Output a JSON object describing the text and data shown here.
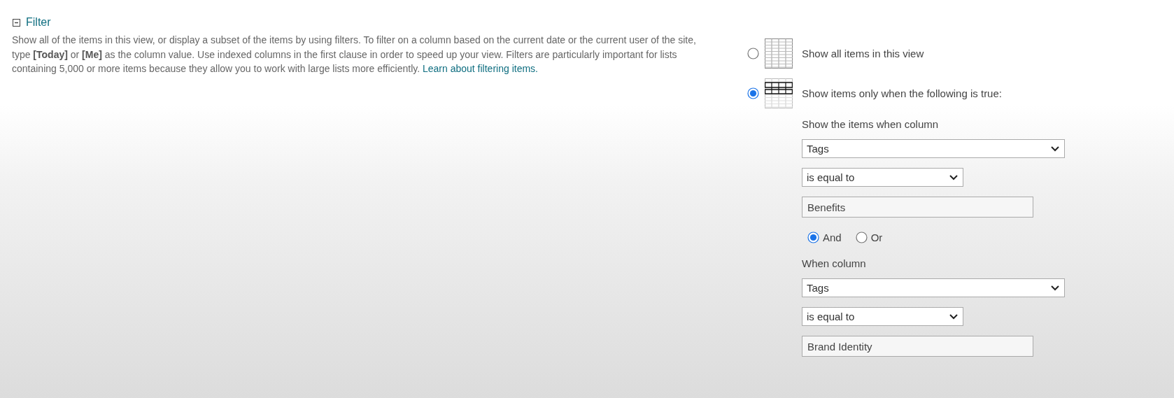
{
  "section": {
    "title": "Filter",
    "expanded": true,
    "description": "Show all of the items in this view, or display a subset of the items by using filters. To filter on a column based on the current date or the current user of the site, type **[Today]** or **[Me]** as the column value. Use indexed columns in the first clause in order to speed up your view. Filters are particularly important for lists containing 5,000 or more items because they allow you to work with large lists more efficiently.",
    "link": "Learn about filtering items."
  },
  "modes": [
    {
      "label": "Show all items in this view",
      "kind": "all",
      "selected": false
    },
    {
      "label": "Show items only when the following is true:",
      "kind": "filtered",
      "selected": true
    }
  ],
  "clauses": [
    {
      "label": "Show the items when column",
      "column": "Tags",
      "operator": "is equal to",
      "value": "Benefits"
    },
    {
      "label": "When column",
      "column": "Tags",
      "operator": "is equal to",
      "value": "Brand Identity"
    }
  ],
  "joiners": [
    {
      "label": "And",
      "selected": true
    },
    {
      "label": "Or",
      "selected": false
    }
  ]
}
